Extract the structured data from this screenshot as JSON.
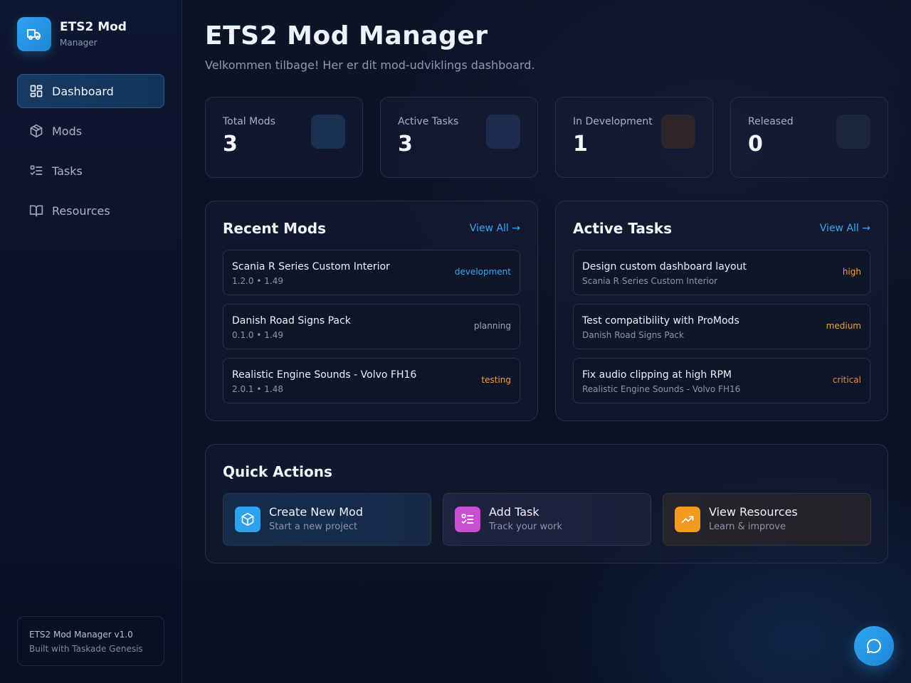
{
  "brand": {
    "title": "ETS2 Mod",
    "subtitle": "Manager"
  },
  "nav": [
    {
      "label": "Dashboard",
      "icon": "dashboard-icon",
      "active": true
    },
    {
      "label": "Mods",
      "icon": "box-icon"
    },
    {
      "label": "Tasks",
      "icon": "list-checks-icon"
    },
    {
      "label": "Resources",
      "icon": "book-icon"
    }
  ],
  "footer": {
    "line1": "ETS2 Mod Manager v1.0",
    "line2": "Built with Taskade Genesis"
  },
  "header": {
    "title": "ETS2 Mod Manager",
    "subtitle": "Velkommen tilbage! Her er dit mod-udviklings dashboard."
  },
  "stats": [
    {
      "label": "Total Mods",
      "value": "3",
      "color": "#1e3a5f"
    },
    {
      "label": "Active Tasks",
      "value": "3",
      "color": "#22335a"
    },
    {
      "label": "In Development",
      "value": "1",
      "color": "#3a2a28"
    },
    {
      "label": "Released",
      "value": "0",
      "color": "#1f2e3e"
    }
  ],
  "recent_mods": {
    "title": "Recent Mods",
    "view_all": "View All →",
    "items": [
      {
        "name": "Scania R Series Custom Interior",
        "meta": "1.2.0 • 1.49",
        "status": "development",
        "color": "#3aa6f0"
      },
      {
        "name": "Danish Road Signs Pack",
        "meta": "0.1.0 • 1.49",
        "status": "planning",
        "color": "#9aa3b6"
      },
      {
        "name": "Realistic Engine Sounds - Volvo FH16",
        "meta": "2.0.1 • 1.48",
        "status": "testing",
        "color": "#f0a03a"
      }
    ]
  },
  "active_tasks": {
    "title": "Active Tasks",
    "view_all": "View All →",
    "items": [
      {
        "name": "Design custom dashboard layout",
        "meta": "Scania R Series Custom Interior",
        "priority": "high",
        "color": "#f0a03a"
      },
      {
        "name": "Test compatibility with ProMods",
        "meta": "Danish Road Signs Pack",
        "priority": "medium",
        "color": "#f0a03a"
      },
      {
        "name": "Fix audio clipping at high RPM",
        "meta": "Realistic Engine Sounds - Volvo FH16",
        "priority": "critical",
        "color": "#e0894a"
      }
    ]
  },
  "quick_actions": {
    "title": "Quick Actions",
    "items": [
      {
        "title": "Create New Mod",
        "subtitle": "Start a new project",
        "icon": "box-icon",
        "accent": "#2ea2ec"
      },
      {
        "title": "Add Task",
        "subtitle": "Track your work",
        "icon": "list-checks-icon",
        "accent": "#c84fd0"
      },
      {
        "title": "View Resources",
        "subtitle": "Learn & improve",
        "icon": "trending-up-icon",
        "accent": "#f39a1f"
      }
    ]
  },
  "chat_button": {
    "icon": "chat-bubble-icon"
  }
}
